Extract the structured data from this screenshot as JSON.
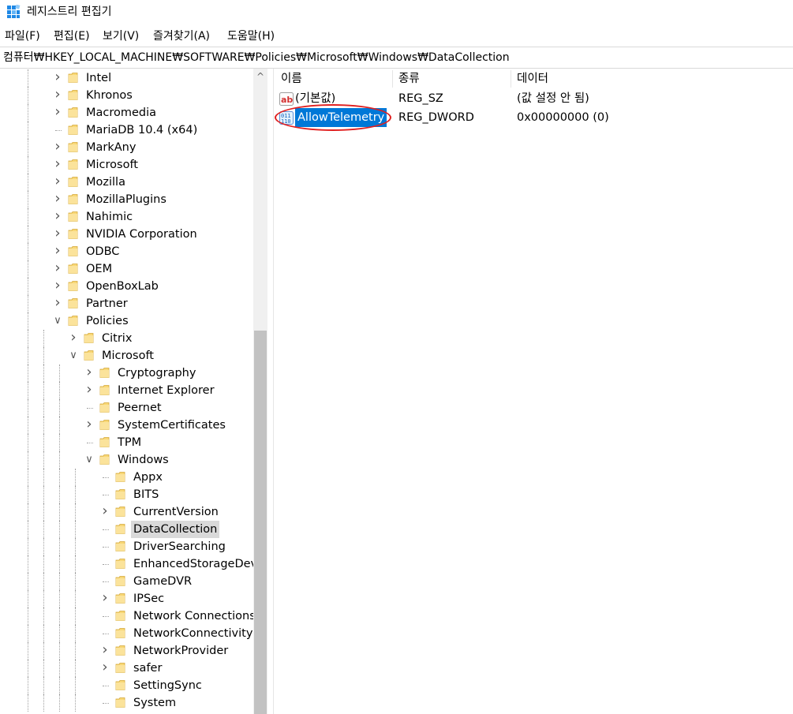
{
  "window": {
    "title": "레지스트리 편집기"
  },
  "menu": [
    "파일(F)",
    "편집(E)",
    "보기(V)",
    "즐겨찾기(A)",
    "도움말(H)"
  ],
  "address": "컴퓨터₩HKEY_LOCAL_MACHINE₩SOFTWARE₩Policies₩Microsoft₩Windows₩DataCollection",
  "tree": [
    {
      "label": "Intel",
      "depth": 0,
      "expander": "collapsed"
    },
    {
      "label": "Khronos",
      "depth": 0,
      "expander": "collapsed"
    },
    {
      "label": "Macromedia",
      "depth": 0,
      "expander": "collapsed"
    },
    {
      "label": "MariaDB 10.4 (x64)",
      "depth": 0,
      "expander": "none"
    },
    {
      "label": "MarkAny",
      "depth": 0,
      "expander": "collapsed"
    },
    {
      "label": "Microsoft",
      "depth": 0,
      "expander": "collapsed"
    },
    {
      "label": "Mozilla",
      "depth": 0,
      "expander": "collapsed"
    },
    {
      "label": "MozillaPlugins",
      "depth": 0,
      "expander": "collapsed"
    },
    {
      "label": "Nahimic",
      "depth": 0,
      "expander": "collapsed"
    },
    {
      "label": "NVIDIA Corporation",
      "depth": 0,
      "expander": "collapsed"
    },
    {
      "label": "ODBC",
      "depth": 0,
      "expander": "collapsed"
    },
    {
      "label": "OEM",
      "depth": 0,
      "expander": "collapsed"
    },
    {
      "label": "OpenBoxLab",
      "depth": 0,
      "expander": "collapsed"
    },
    {
      "label": "Partner",
      "depth": 0,
      "expander": "collapsed"
    },
    {
      "label": "Policies",
      "depth": 0,
      "expander": "expanded"
    },
    {
      "label": "Citrix",
      "depth": 1,
      "expander": "collapsed"
    },
    {
      "label": "Microsoft",
      "depth": 1,
      "expander": "expanded"
    },
    {
      "label": "Cryptography",
      "depth": 2,
      "expander": "collapsed"
    },
    {
      "label": "Internet Explorer",
      "depth": 2,
      "expander": "collapsed"
    },
    {
      "label": "Peernet",
      "depth": 2,
      "expander": "none"
    },
    {
      "label": "SystemCertificates",
      "depth": 2,
      "expander": "collapsed"
    },
    {
      "label": "TPM",
      "depth": 2,
      "expander": "none"
    },
    {
      "label": "Windows",
      "depth": 2,
      "expander": "expanded"
    },
    {
      "label": "Appx",
      "depth": 3,
      "expander": "none"
    },
    {
      "label": "BITS",
      "depth": 3,
      "expander": "none"
    },
    {
      "label": "CurrentVersion",
      "depth": 3,
      "expander": "collapsed"
    },
    {
      "label": "DataCollection",
      "depth": 3,
      "expander": "none",
      "selected": true
    },
    {
      "label": "DriverSearching",
      "depth": 3,
      "expander": "none"
    },
    {
      "label": "EnhancedStorageDevices",
      "depth": 3,
      "expander": "none"
    },
    {
      "label": "GameDVR",
      "depth": 3,
      "expander": "none"
    },
    {
      "label": "IPSec",
      "depth": 3,
      "expander": "collapsed"
    },
    {
      "label": "Network Connections",
      "depth": 3,
      "expander": "none"
    },
    {
      "label": "NetworkConnectivityStatusIndicator",
      "depth": 3,
      "expander": "none"
    },
    {
      "label": "NetworkProvider",
      "depth": 3,
      "expander": "collapsed"
    },
    {
      "label": "safer",
      "depth": 3,
      "expander": "collapsed"
    },
    {
      "label": "SettingSync",
      "depth": 3,
      "expander": "none"
    },
    {
      "label": "System",
      "depth": 3,
      "expander": "none"
    }
  ],
  "list": {
    "columns": [
      "이름",
      "종류",
      "데이터"
    ],
    "rows": [
      {
        "name": "(기본값)",
        "type": "REG_SZ",
        "data": "(값 설정 안 됨)",
        "icon": "string-value-icon",
        "selected": false
      },
      {
        "name": "AllowTelemetry",
        "type": "REG_DWORD",
        "data": "0x00000000 (0)",
        "icon": "dword-value-icon",
        "selected": true
      }
    ]
  },
  "colors": {
    "selection": "#0078d7",
    "folder": "#f8d775",
    "highlight_ring": "#e02020"
  }
}
